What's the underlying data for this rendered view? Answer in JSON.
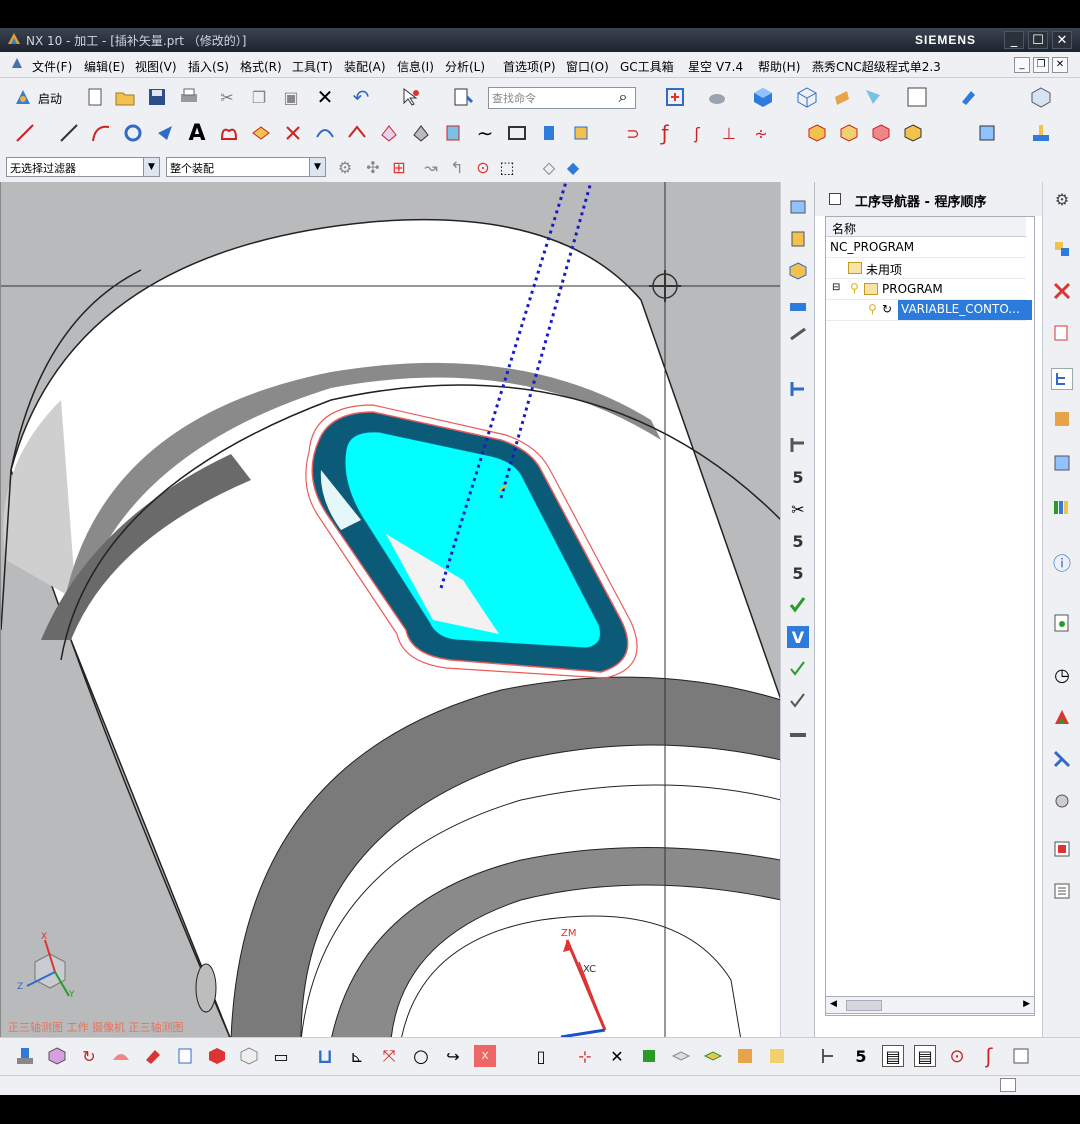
{
  "window": {
    "title": "NX 10 - 加工 - [插补矢量.prt （修改的）]",
    "brand": "SIEMENS",
    "controls": {
      "minimize": "_",
      "maximize": "☐",
      "close": "✕"
    }
  },
  "menubar": {
    "items": [
      "文件(F)",
      "编辑(E)",
      "视图(V)",
      "插入(S)",
      "格式(R)",
      "工具(T)",
      "装配(A)",
      "信息(I)",
      "分析(L)",
      "首选项(P)",
      "窗口(O)",
      "GC工具箱",
      "星空 V7.4",
      "帮助(H)",
      "燕秀CNC超级程式单2.3"
    ]
  },
  "toolbar": {
    "start_label": "启动",
    "search_placeholder": "查找命令",
    "selection_filter": "无选择过滤器",
    "scope": "整个装配"
  },
  "viewport": {
    "view_label": "正三轴测图  工作  摄像机  正三轴测图",
    "axis_labels": {
      "zm": "ZM",
      "xc": "XC"
    },
    "triad": {
      "x": "X",
      "y": "Y",
      "z": "Z"
    },
    "colors": {
      "surface": "#00ffff",
      "dark_wall": "#0b5a78",
      "toolpath": "#1a1ac8",
      "outline": "#e85c5c"
    }
  },
  "navigator": {
    "title": "工序导航器 - 程序顺序",
    "column_header": "名称",
    "root": "NC_PROGRAM",
    "unused": "未用项",
    "program": "PROGRAM",
    "operation": "VARIABLE_CONTO..."
  }
}
